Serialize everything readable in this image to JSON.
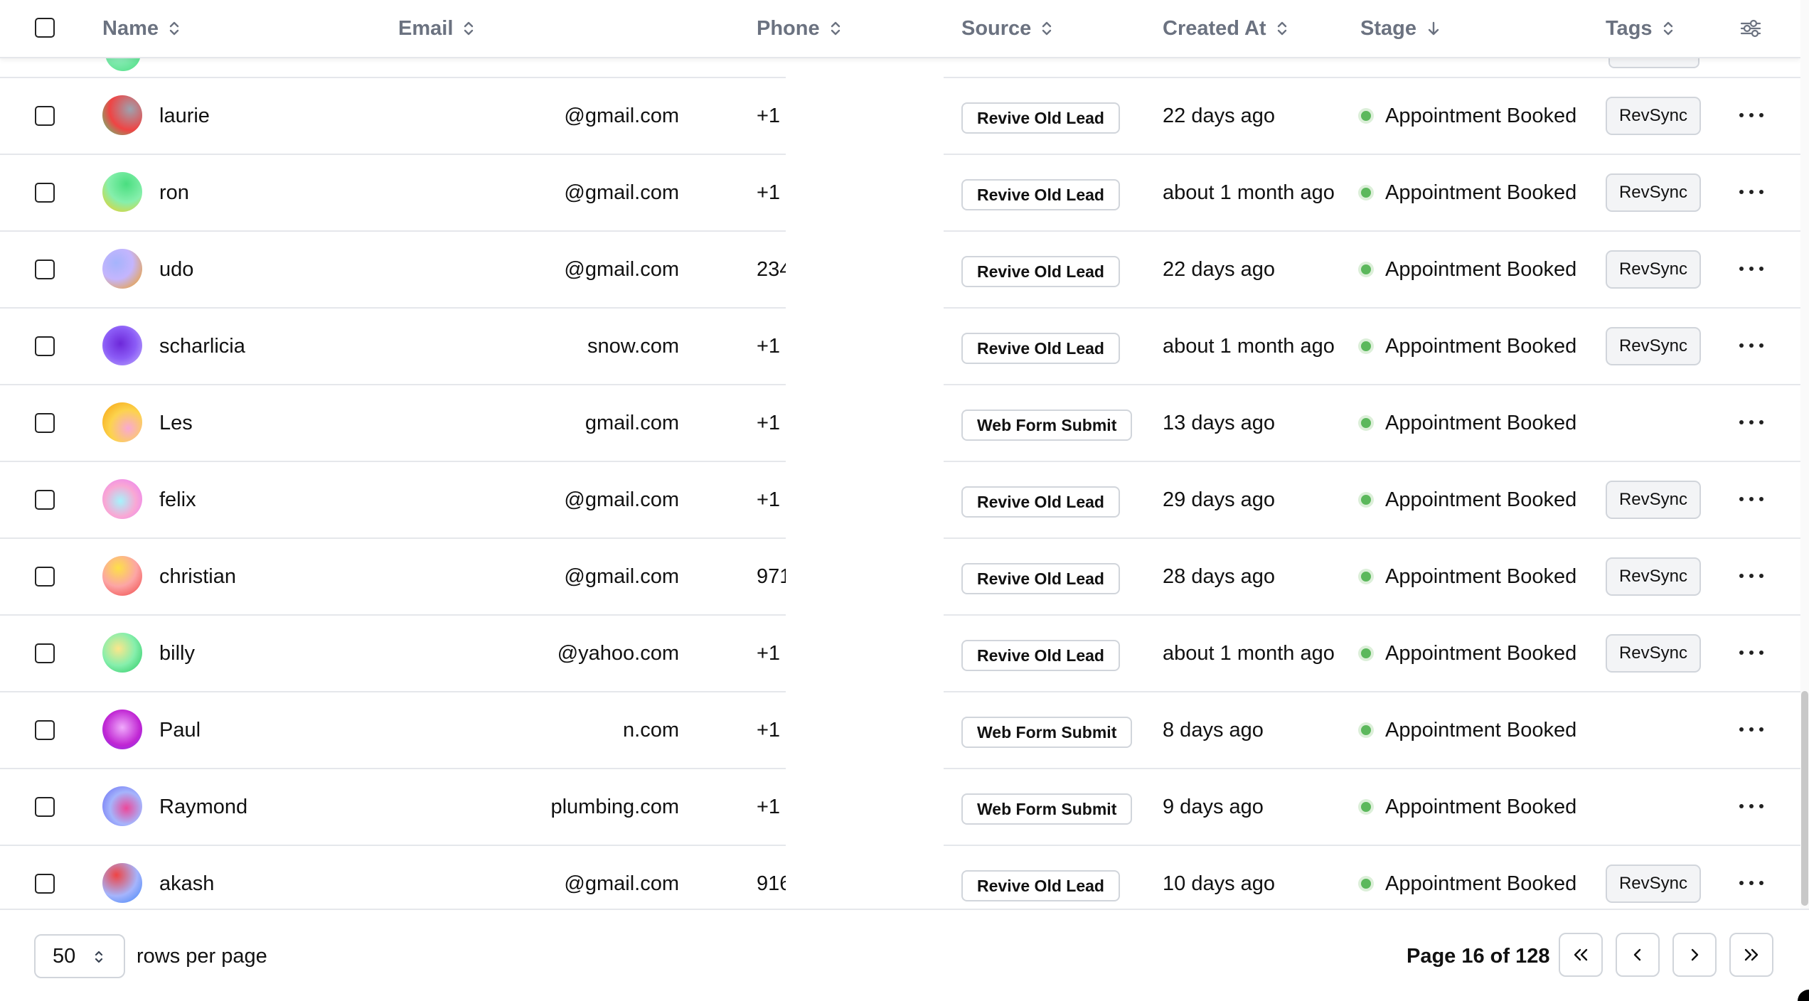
{
  "header": {
    "name": "Name",
    "email": "Email",
    "phone": "Phone",
    "source": "Source",
    "created_at": "Created At",
    "stage": "Stage",
    "tags": "Tags"
  },
  "rows": [
    {
      "name": "laurie",
      "email": "@gmail.com",
      "phone": "+1",
      "source": "Revive Old Lead",
      "created": "22 days ago",
      "stage": "Appointment Booked",
      "tag": "RevSync"
    },
    {
      "name": "ron",
      "email": "@gmail.com",
      "phone": "+1",
      "source": "Revive Old Lead",
      "created": "about 1 month ago",
      "stage": "Appointment Booked",
      "tag": "RevSync"
    },
    {
      "name": "udo",
      "email": "@gmail.com",
      "phone": "234",
      "source": "Revive Old Lead",
      "created": "22 days ago",
      "stage": "Appointment Booked",
      "tag": "RevSync"
    },
    {
      "name": "scharlicia",
      "email": "snow.com",
      "phone": "+1",
      "source": "Revive Old Lead",
      "created": "about 1 month ago",
      "stage": "Appointment Booked",
      "tag": "RevSync"
    },
    {
      "name": "Les",
      "email": "gmail.com",
      "phone": "+1",
      "source": "Web Form Submit",
      "created": "13 days ago",
      "stage": "Appointment Booked",
      "tag": ""
    },
    {
      "name": "felix",
      "email": "@gmail.com",
      "phone": "+1",
      "source": "Revive Old Lead",
      "created": "29 days ago",
      "stage": "Appointment Booked",
      "tag": "RevSync"
    },
    {
      "name": "christian",
      "email": "@gmail.com",
      "phone": "971",
      "source": "Revive Old Lead",
      "created": "28 days ago",
      "stage": "Appointment Booked",
      "tag": "RevSync"
    },
    {
      "name": "billy",
      "email": "@yahoo.com",
      "phone": "+1",
      "source": "Revive Old Lead",
      "created": "about 1 month ago",
      "stage": "Appointment Booked",
      "tag": "RevSync"
    },
    {
      "name": "Paul",
      "email": "n.com",
      "phone": "+1",
      "source": "Web Form Submit",
      "created": "8 days ago",
      "stage": "Appointment Booked",
      "tag": ""
    },
    {
      "name": "Raymond",
      "email": "plumbing.com",
      "phone": "+1",
      "source": "Web Form Submit",
      "created": "9 days ago",
      "stage": "Appointment Booked",
      "tag": ""
    },
    {
      "name": "akash",
      "email": "@gmail.com",
      "phone": "916",
      "source": "Revive Old Lead",
      "created": "10 days ago",
      "stage": "Appointment Booked",
      "tag": "RevSync"
    }
  ],
  "pagination": {
    "rows_per_page_value": "50",
    "rows_per_page_label": "rows per page",
    "page_info": "Page 16 of 128"
  },
  "colors": {
    "stage_dot": "#5cb85c",
    "border": "#e5e7eb"
  }
}
